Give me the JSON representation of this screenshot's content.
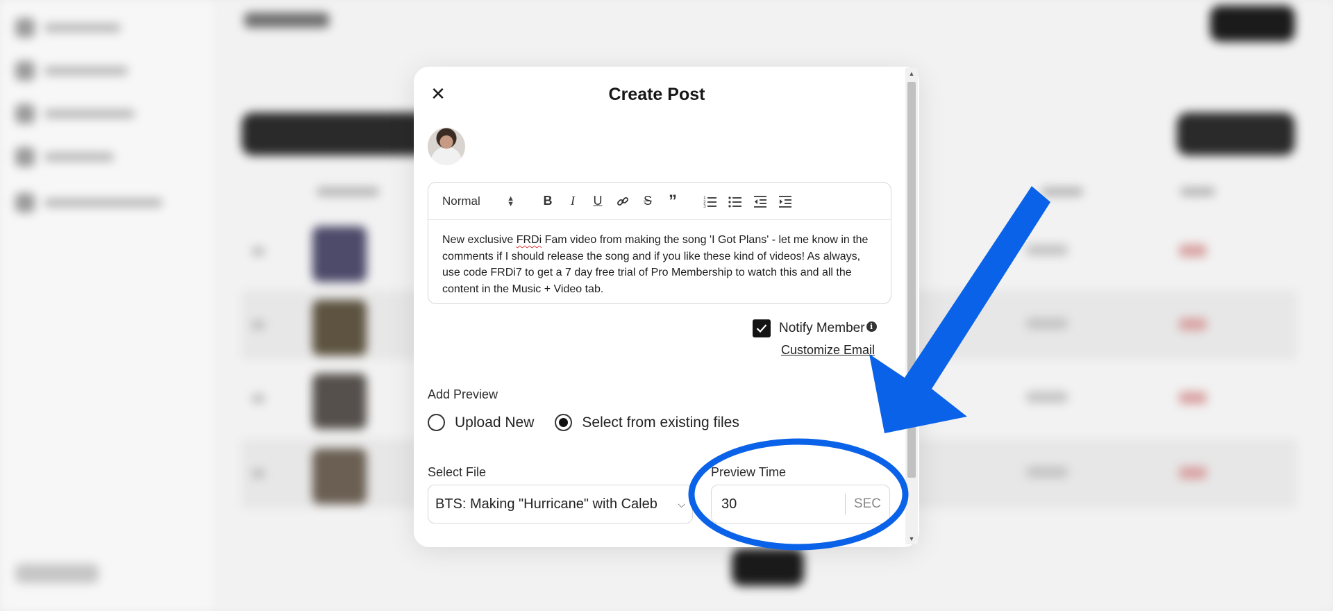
{
  "modal": {
    "title": "Create Post",
    "close_icon": "close-icon"
  },
  "editor": {
    "format": "Normal",
    "toolbar": [
      "bold-icon",
      "italic-icon",
      "underline-icon",
      "link-icon",
      "strikethrough-icon",
      "quote-icon",
      "ordered-list-icon",
      "bullet-list-icon",
      "outdent-icon",
      "indent-icon"
    ],
    "body_pre": "New exclusive ",
    "body_flag": "FRDi",
    "body_post": " Fam video from making the song 'I Got Plans' - let me know in the comments if I should release the song and if you like these kind of videos! As always, use code FRDi7 to get a 7 day free trial of Pro Membership to watch this and all the content in the Music + Video tab."
  },
  "notify": {
    "checked": true,
    "label": "Notify Member",
    "customize_link": "Customize Email"
  },
  "preview": {
    "heading": "Add Preview",
    "option_upload": "Upload New",
    "option_existing": "Select from existing files",
    "selected_option": "existing",
    "file_label": "Select File",
    "file_value": "BTS: Making \"Hurricane\" with Caleb",
    "time_label": "Preview Time",
    "time_value": "30",
    "time_unit": "SEC"
  },
  "colors": {
    "annotation_blue": "#0a62e8",
    "checkbox": "#141414"
  }
}
